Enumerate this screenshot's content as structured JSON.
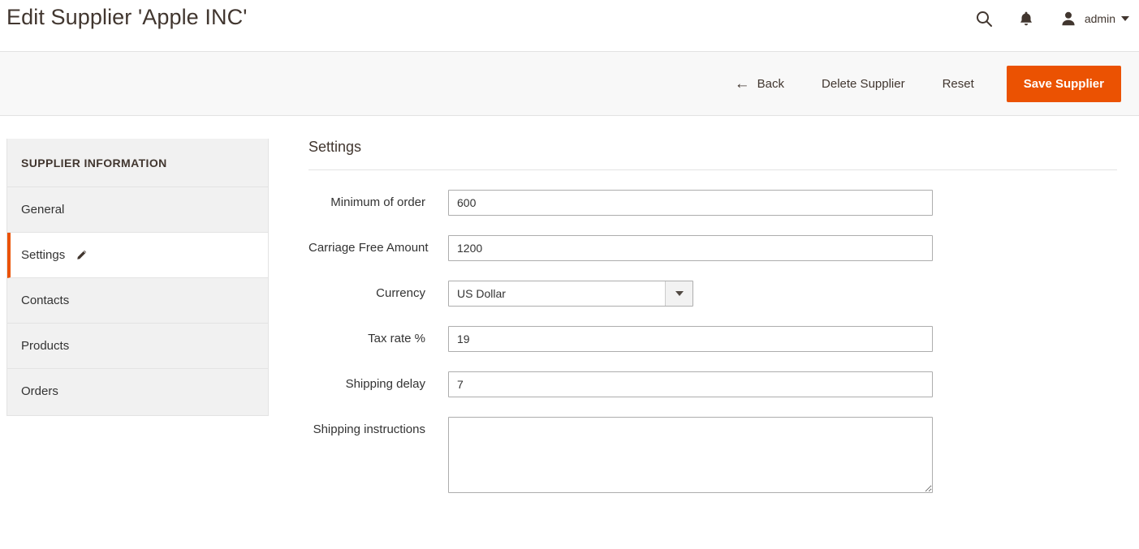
{
  "header": {
    "title": "Edit Supplier 'Apple INC'",
    "search_icon": "search-icon",
    "notifications_icon": "bell-icon",
    "user_icon": "user-avatar-icon",
    "user_name": "admin",
    "caret_icon": "chevron-down-icon"
  },
  "toolbar": {
    "back_arrow": "←",
    "back_label": "Back",
    "delete_label": "Delete Supplier",
    "reset_label": "Reset",
    "save_label": "Save Supplier",
    "save_color": "#eb5202"
  },
  "sidebar": {
    "title": "SUPPLIER INFORMATION",
    "active_accent": "#eb5202",
    "items": [
      {
        "label": "General",
        "icon": ""
      },
      {
        "label": "Settings",
        "icon": "pencil-icon"
      },
      {
        "label": "Contacts",
        "icon": ""
      },
      {
        "label": "Products",
        "icon": ""
      },
      {
        "label": "Orders",
        "icon": ""
      }
    ]
  },
  "form": {
    "section_title": "Settings",
    "fields": {
      "minimum_of_order": {
        "label": "Minimum of order",
        "value": "600",
        "placeholder": ""
      },
      "carriage_free_amount": {
        "label": "Carriage Free Amount",
        "value": "1200",
        "placeholder": ""
      },
      "currency": {
        "label": "Currency",
        "value": "US Dollar"
      },
      "tax_rate": {
        "label": "Tax rate %",
        "value": "19",
        "placeholder": ""
      },
      "shipping_delay": {
        "label": "Shipping delay",
        "value": "7",
        "placeholder": ""
      },
      "shipping_instructions": {
        "label": "Shipping instructions",
        "value": "",
        "placeholder": ""
      }
    }
  }
}
